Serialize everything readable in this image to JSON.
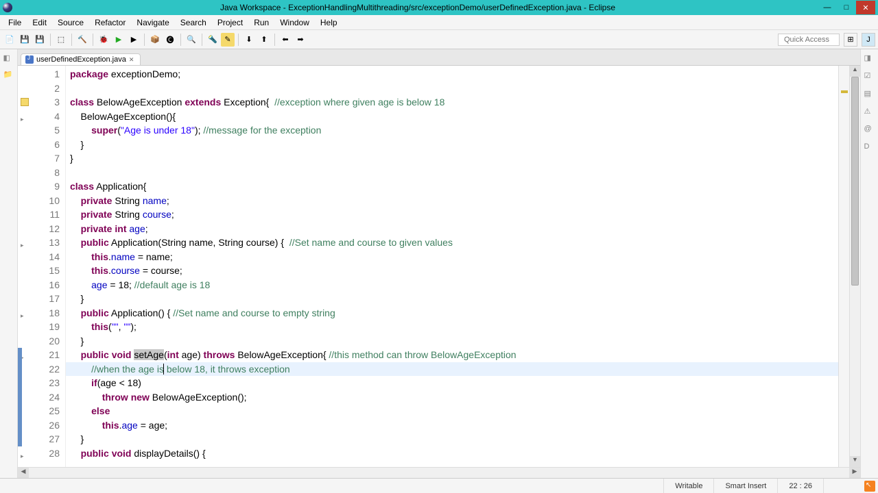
{
  "window": {
    "title": "Java Workspace - ExceptionHandlingMultithreading/src/exceptionDemo/userDefinedException.java - Eclipse"
  },
  "menu": {
    "items": [
      "File",
      "Edit",
      "Source",
      "Refactor",
      "Navigate",
      "Search",
      "Project",
      "Run",
      "Window",
      "Help"
    ]
  },
  "toolbar": {
    "quick_access_placeholder": "Quick Access"
  },
  "tab": {
    "filename": "userDefinedException.java"
  },
  "code": {
    "lines": [
      {
        "n": 1,
        "html": "<span class='kw'>package</span> exceptionDemo;"
      },
      {
        "n": 2,
        "html": ""
      },
      {
        "n": 3,
        "html": "<span class='kw'>class</span> BelowAgeException <span class='kw'>extends</span> Exception{  <span class='cmt'>//exception where given age is below 18</span>",
        "warn": true
      },
      {
        "n": 4,
        "html": "    BelowAgeException(){",
        "method": true
      },
      {
        "n": 5,
        "html": "        <span class='kw'>super</span>(<span class='str'>\"Age is under 18\"</span>); <span class='cmt'>//message for the exception</span>"
      },
      {
        "n": 6,
        "html": "    }"
      },
      {
        "n": 7,
        "html": "}"
      },
      {
        "n": 8,
        "html": ""
      },
      {
        "n": 9,
        "html": "<span class='kw'>class</span> Application{"
      },
      {
        "n": 10,
        "html": "    <span class='kw'>private</span> String <span class='fld'>name</span>;"
      },
      {
        "n": 11,
        "html": "    <span class='kw'>private</span> String <span class='fld'>course</span>;"
      },
      {
        "n": 12,
        "html": "    <span class='kw'>private</span> <span class='kw'>int</span> <span class='fld'>age</span>;"
      },
      {
        "n": 13,
        "html": "    <span class='kw'>public</span> Application(String name, String course) {  <span class='cmt'>//Set name and course to given values</span>",
        "method": true
      },
      {
        "n": 14,
        "html": "        <span class='kw'>this</span>.<span class='fld'>name</span> = name;"
      },
      {
        "n": 15,
        "html": "        <span class='kw'>this</span>.<span class='fld'>course</span> = course;"
      },
      {
        "n": 16,
        "html": "        <span class='fld'>age</span> = 18; <span class='cmt'>//default age is 18</span>"
      },
      {
        "n": 17,
        "html": "    }"
      },
      {
        "n": 18,
        "html": "    <span class='kw'>public</span> Application() { <span class='cmt'>//Set name and course to empty string</span>",
        "method": true
      },
      {
        "n": 19,
        "html": "        <span class='kw'>this</span>(<span class='str'>\"\"</span>, <span class='str'>\"\"</span>);"
      },
      {
        "n": 20,
        "html": "    }"
      },
      {
        "n": 21,
        "html": "    <span class='kw'>public</span> <span class='kw'>void</span> <span class='sel'>setAge</span>(<span class='kw'>int</span> age) <span class='kw'>throws</span> BelowAgeException{ <span class='cmt'>//this method can throw BelowAgeException</span>",
        "method": true,
        "bluebar": true
      },
      {
        "n": 22,
        "html": "        <span class='cmt'>//when the age is<span class='cursor'></span> below 18, it throws exception</span>",
        "highlight": true,
        "bluebar": true
      },
      {
        "n": 23,
        "html": "        <span class='kw'>if</span>(age &lt; 18)",
        "bluebar": true
      },
      {
        "n": 24,
        "html": "            <span class='kw'>throw</span> <span class='kw'>new</span> BelowAgeException();",
        "bluebar": true
      },
      {
        "n": 25,
        "html": "        <span class='kw'>else</span>",
        "bluebar": true
      },
      {
        "n": 26,
        "html": "            <span class='kw'>this</span>.<span class='fld'>age</span> = age;",
        "bluebar": true
      },
      {
        "n": 27,
        "html": "    }",
        "bluebar": true
      },
      {
        "n": 28,
        "html": "    <span class='kw'>public</span> <span class='kw'>void</span> displayDetails() {",
        "method": true
      }
    ]
  },
  "status": {
    "writable": "Writable",
    "insert_mode": "Smart Insert",
    "cursor_pos": "22 : 26"
  }
}
